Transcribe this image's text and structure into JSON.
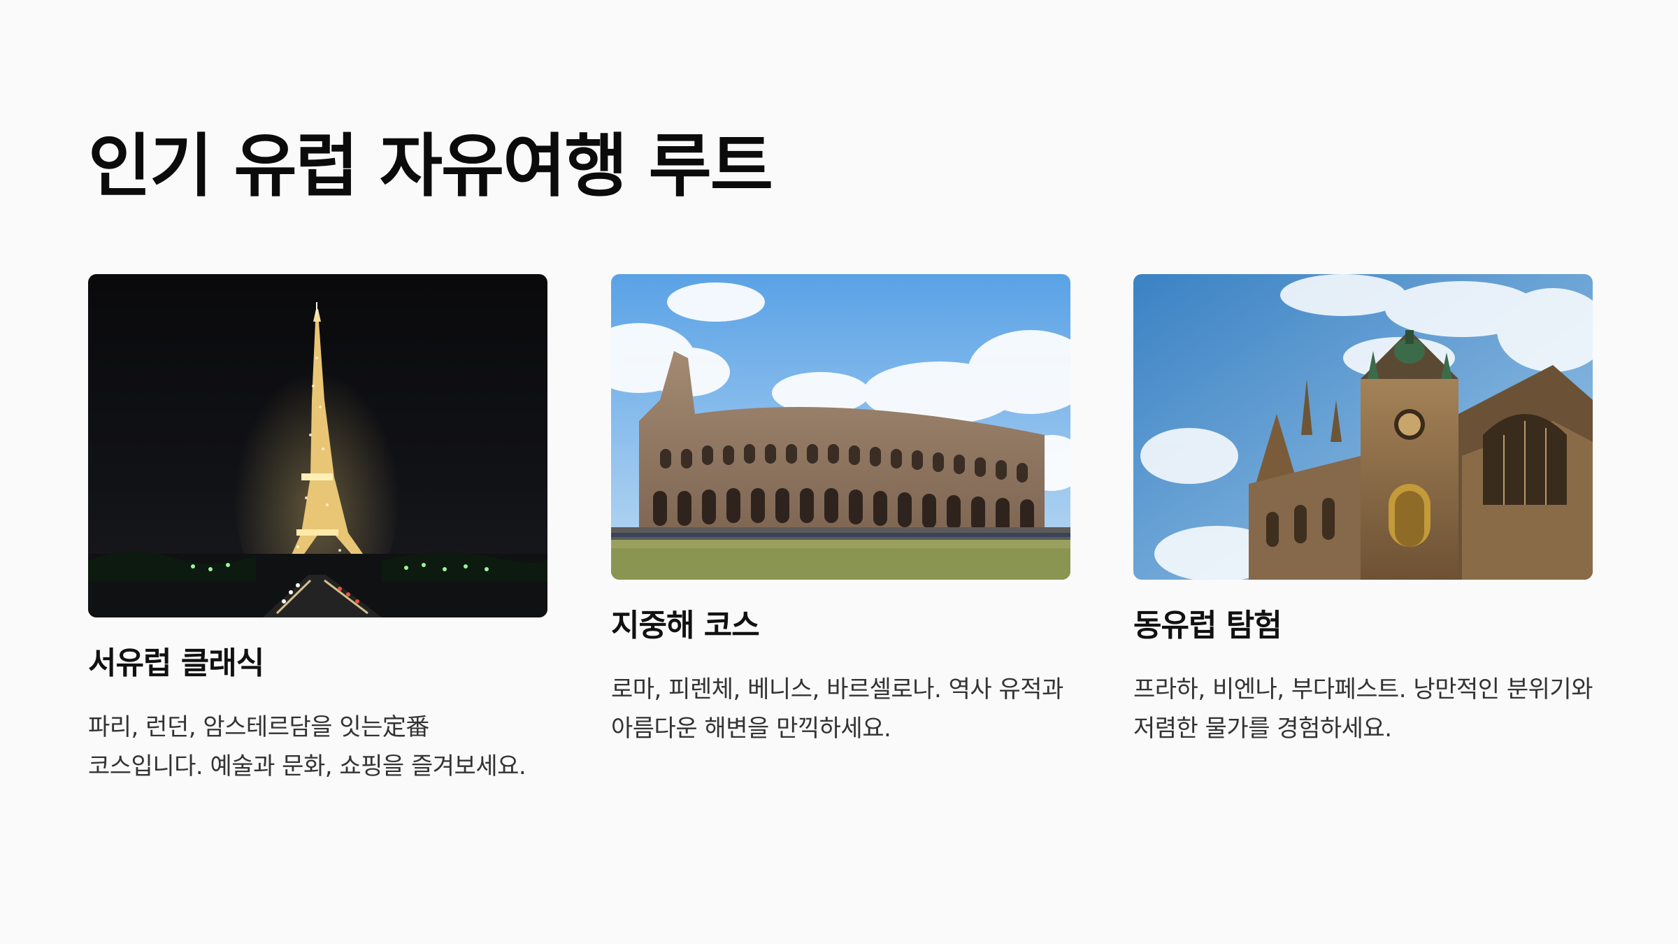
{
  "page": {
    "title": "인기 유럽 자유여행 루트"
  },
  "cards": [
    {
      "title": "서유럽 클래식",
      "description": "파리, 런던, 암스테르담을 잇는定番 코스입니다. 예술과 문화, 쇼핑을 즐겨보세요.",
      "image_subject": "eiffel-tower-night"
    },
    {
      "title": "지중해 코스",
      "description": "로마, 피렌체, 베니스, 바르셀로나. 역사 유적과 아름다운 해변을 만끽하세요.",
      "image_subject": "colosseum"
    },
    {
      "title": "동유럽 탐험",
      "description": "프라하, 비엔나, 부다페스트. 낭만적인 분위기와 저렴한 물가를 경험하세요.",
      "image_subject": "prague-cathedral"
    }
  ],
  "colors": {
    "background": "#fafafa",
    "title": "#0b0b0b",
    "text": "#333333"
  }
}
